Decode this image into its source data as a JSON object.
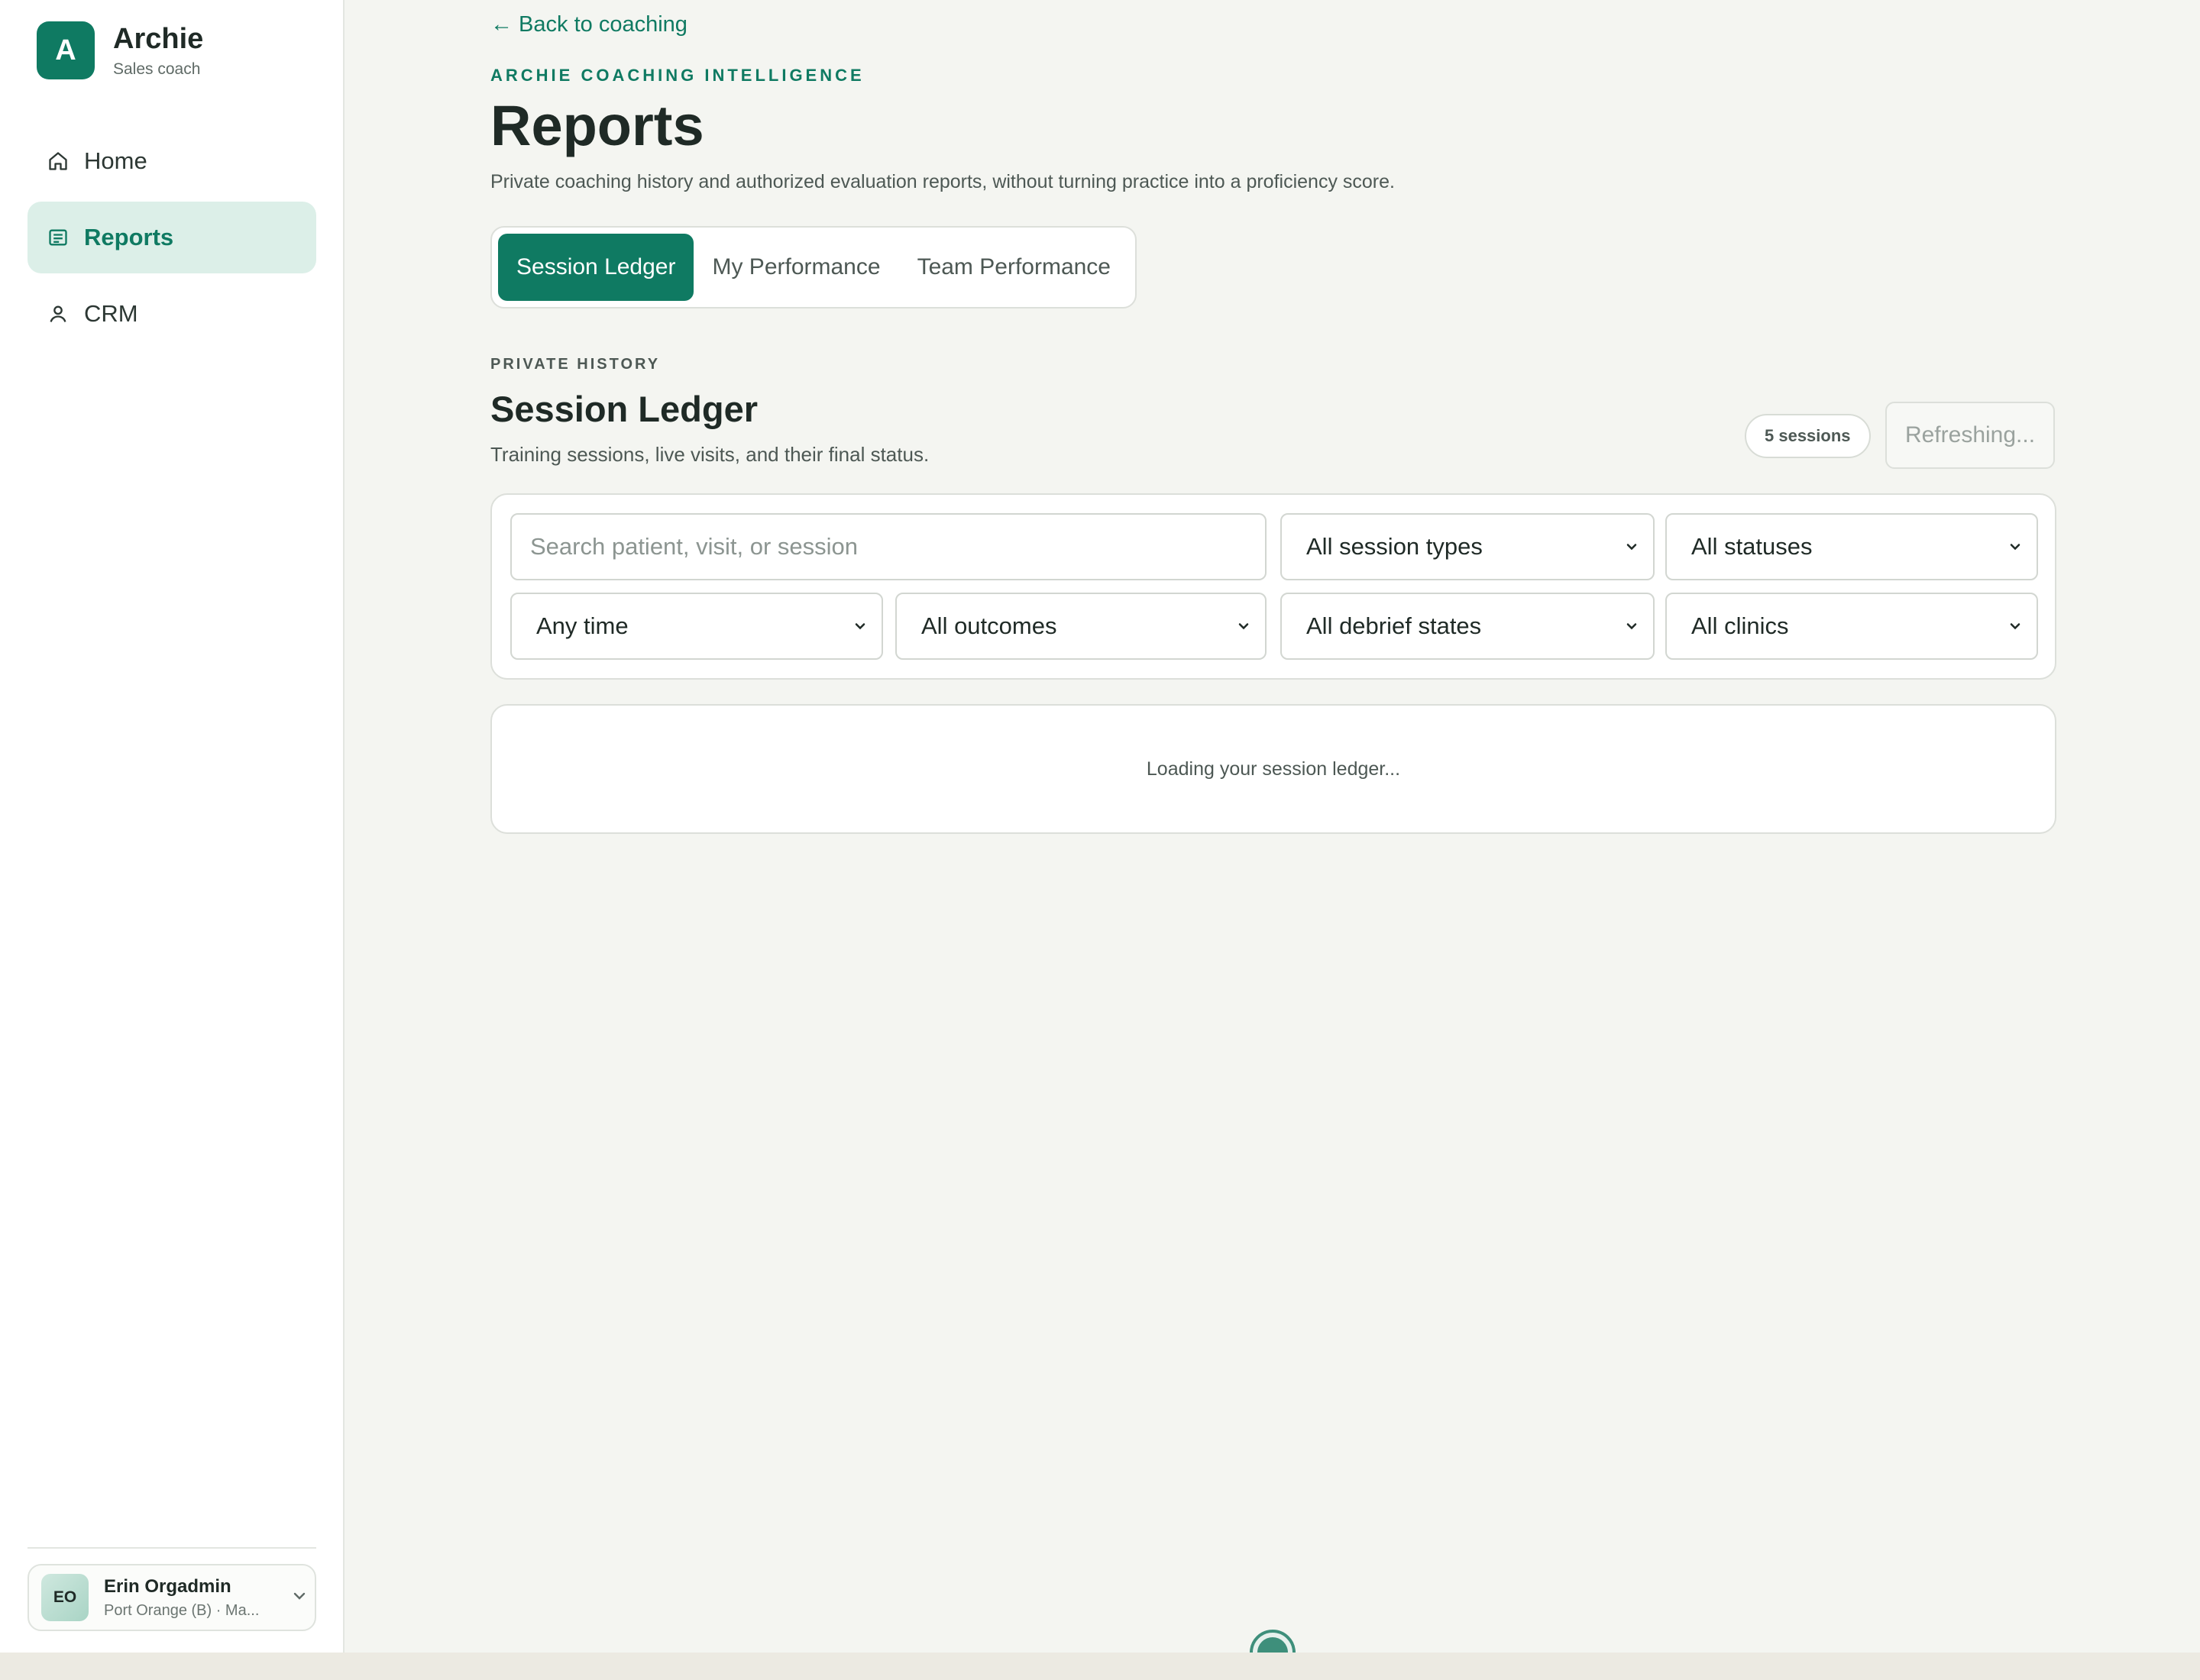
{
  "brand": {
    "logo_letter": "A",
    "name": "Archie",
    "subtitle": "Sales coach"
  },
  "nav": [
    {
      "label": "Home",
      "icon": "home-icon",
      "active": false
    },
    {
      "label": "Reports",
      "icon": "reports-icon",
      "active": true
    },
    {
      "label": "CRM",
      "icon": "person-icon",
      "active": false
    }
  ],
  "user": {
    "initials": "EO",
    "name": "Erin Orgadmin",
    "org": "Port Orange (B) · Ma..."
  },
  "header": {
    "back_link": "← Back to coaching",
    "eyebrow": "ARCHIE COACHING INTELLIGENCE",
    "title": "Reports",
    "description": "Private coaching history and authorized evaluation reports, without turning practice into a proficiency score."
  },
  "tabs": [
    {
      "label": "Session Ledger",
      "active": true
    },
    {
      "label": "My Performance",
      "active": false
    },
    {
      "label": "Team Performance",
      "active": false
    }
  ],
  "section": {
    "eyebrow": "PRIVATE HISTORY",
    "title": "Session Ledger",
    "description": "Training sessions, live visits, and their final status.",
    "count_badge": "5 sessions",
    "refresh_label": "Refreshing..."
  },
  "filters": {
    "search_placeholder": "Search patient, visit, or session",
    "session_type": "All session types",
    "status": "All statuses",
    "time": "Any time",
    "outcome": "All outcomes",
    "debrief": "All debrief states",
    "clinic": "All clinics"
  },
  "loading_text": "Loading your session ledger...",
  "colors": {
    "accent": "#0f7a62",
    "accent_soft": "#dcefe8",
    "background": "#f4f5f1"
  }
}
